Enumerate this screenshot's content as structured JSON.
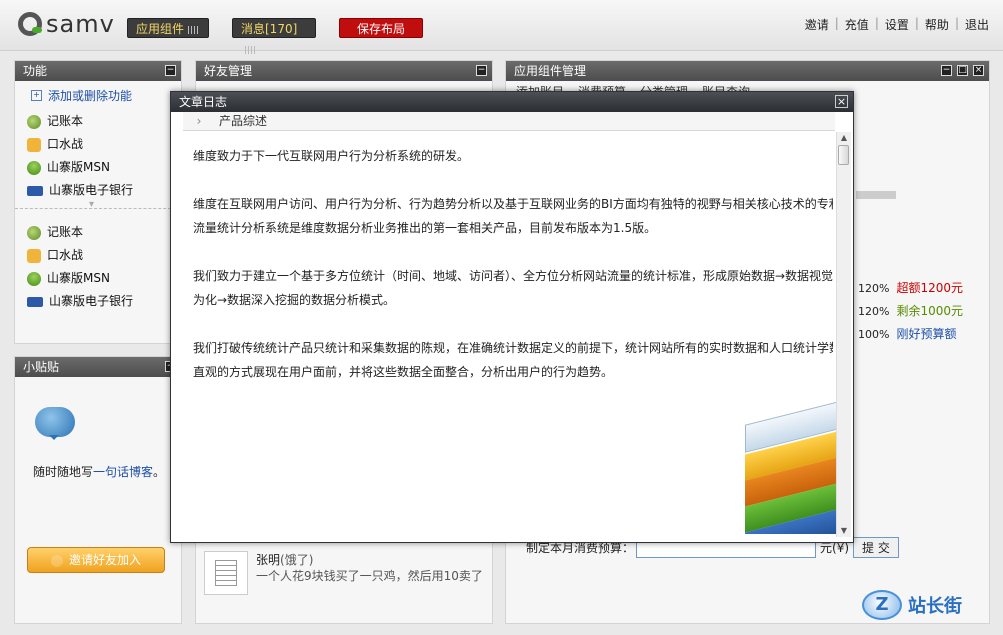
{
  "header": {
    "brand": "samv",
    "app_widget_btn": "应用组件",
    "messages_btn": "消息[170]",
    "save_layout_btn": "保存布局",
    "links": [
      "邀请",
      "充值",
      "设置",
      "帮助",
      "退出"
    ]
  },
  "functions_panel": {
    "title": "功能",
    "add_remove": "添加或删除功能",
    "items_top": [
      "记账本",
      "口水战",
      "山寨版MSN",
      "山寨版电子银行"
    ],
    "items_bottom": [
      "记账本",
      "口水战",
      "山寨版MSN",
      "山寨版电子银行"
    ]
  },
  "friends_panel": {
    "title": "好友管理",
    "post_name": "张明",
    "post_status": "(饿了)",
    "post_text": "一个人花9块钱买了一只鸡，然后用10卖了"
  },
  "widget_panel": {
    "title": "应用组件管理",
    "tabs": [
      "添加账目",
      "消费预算",
      "分类管理",
      "账目查询"
    ],
    "rows": [
      {
        "pct": "120%",
        "status": "超额1200元",
        "color": "#cc0000"
      },
      {
        "pct": "120%",
        "status": "剩余1000元",
        "color": "#5a8a00"
      },
      {
        "pct": "100%",
        "status": "刚好预算额",
        "color": "#1d4fa6"
      }
    ],
    "budget_label": "制定本月消费预算：",
    "budget_value": "",
    "currency": "元(¥)",
    "submit": "提 交"
  },
  "tips_panel": {
    "title": "小贴贴",
    "text_prefix": "随时随地写",
    "text_link": "一句话博客",
    "text_suffix": "。",
    "invite_btn": "邀请好友加入"
  },
  "modal": {
    "title": "文章日志",
    "close": "×",
    "tab": "产品综述",
    "paragraphs": [
      [
        "维度致力于下一代互联网用户行为分析系统的研发。"
      ],
      [
        "维度在互联网用户访问、用户行为分析、行为趋势分析以及基于互联网业务的BI方面均有独特的视野与相关核心技术的专利",
        "流量统计分析系统是维度数据分析业务推出的第一套相关产品，目前发布版本为1.5版。"
      ],
      [
        "我们致力于建立一个基于多方位统计（时间、地域、访问者）、全方位分析网站流量的统计标准，形成原始数据→数据视觉",
        "为化→数据深入挖掘的数据分析模式。"
      ],
      [
        "我们打破传统统计产品只统计和采集数据的陈规，在准确统计数据定义的前提下，统计网站所有的实时数据和人口统计学数",
        "直观的方式展现在用户面前，并将这些数据全面整合，分析出用户的行为趋势。"
      ]
    ]
  },
  "watermark": "站长街"
}
